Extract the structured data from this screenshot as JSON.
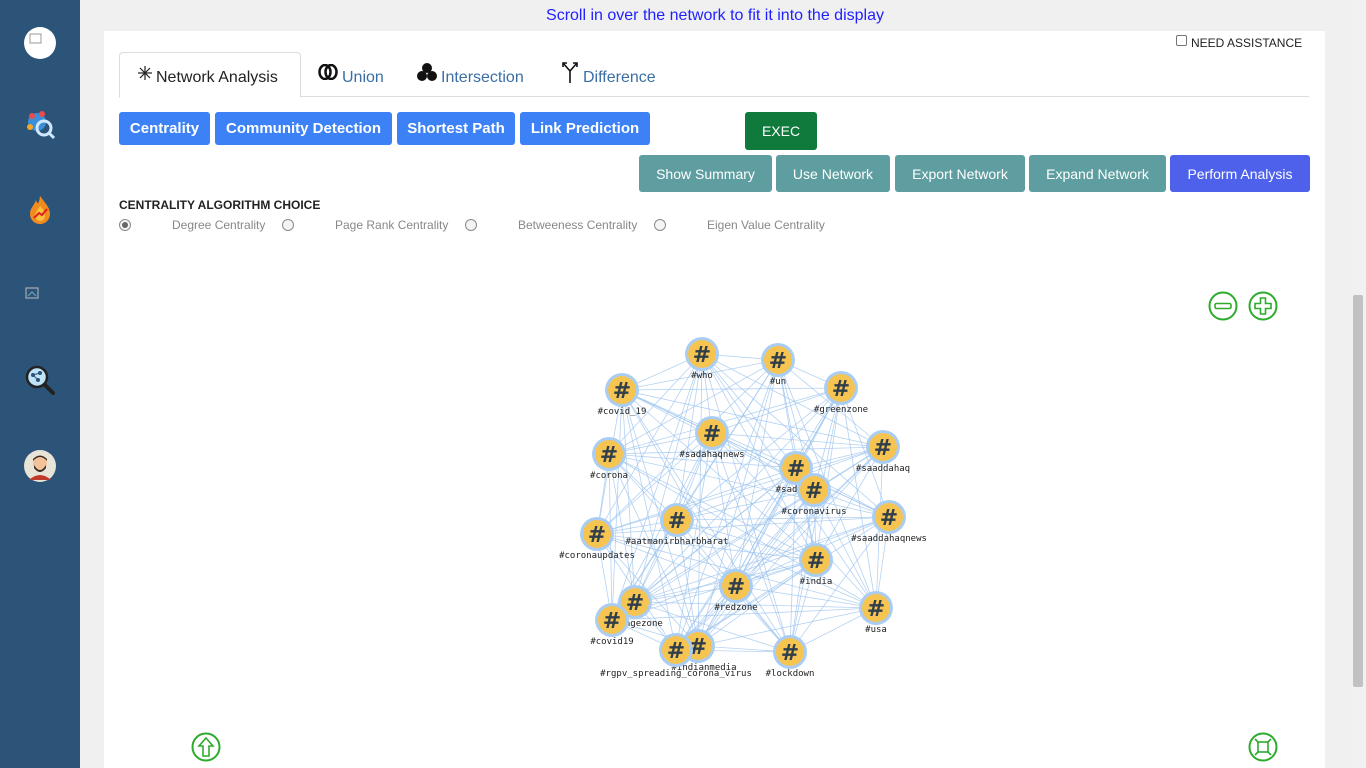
{
  "hint": "Scroll in over the network to fit it into the display",
  "assistance": {
    "label": "NEED ASSISTANCE",
    "checked": false
  },
  "tabs": [
    {
      "label": "Network Analysis",
      "icon": "asterisk-icon",
      "active": true
    },
    {
      "label": "Union",
      "icon": "union-rings-icon",
      "active": false
    },
    {
      "label": "Intersection",
      "icon": "intersection-circles-icon",
      "active": false
    },
    {
      "label": "Difference",
      "icon": "difference-fork-icon",
      "active": false
    }
  ],
  "analysis_buttons": [
    {
      "label": "Centrality"
    },
    {
      "label": "Community Detection"
    },
    {
      "label": "Shortest Path"
    },
    {
      "label": "Link Prediction"
    }
  ],
  "exec_label": "EXEC",
  "actions": [
    {
      "label": "Show Summary"
    },
    {
      "label": "Use Network"
    },
    {
      "label": "Export Network"
    },
    {
      "label": "Expand Network"
    },
    {
      "label": "Perform Analysis"
    }
  ],
  "algorithm": {
    "title": "CENTRALITY ALGORITHM CHOICE",
    "options": [
      {
        "label": "Degree Centrality",
        "selected": true
      },
      {
        "label": "Page Rank Centrality",
        "selected": false
      },
      {
        "label": "Betweeness Centrality",
        "selected": false
      },
      {
        "label": "Eigen Value Centrality",
        "selected": false
      }
    ]
  },
  "network": {
    "node_icon": "hashtag-icon",
    "nodes": [
      {
        "label": "#who"
      },
      {
        "label": "#un"
      },
      {
        "label": "#covid_19"
      },
      {
        "label": "#greenzone"
      },
      {
        "label": "#sadahaqnews"
      },
      {
        "label": "#corona"
      },
      {
        "label": "#saaddahaq"
      },
      {
        "label": "#sadah"
      },
      {
        "label": "#coronavirus"
      },
      {
        "label": "#saaddahaqnews"
      },
      {
        "label": "#aatmanirbharbharat"
      },
      {
        "label": "#coronaupdates"
      },
      {
        "label": "#india"
      },
      {
        "label": "#redzone"
      },
      {
        "label": "#orangezone"
      },
      {
        "label": "#usa"
      },
      {
        "label": "#covid19"
      },
      {
        "label": "#indianmedia"
      },
      {
        "label": "#rgpv_spreading_corona_virus"
      },
      {
        "label": "#lockdown"
      }
    ]
  },
  "controls": {
    "zoom_out": "minus-circle-icon",
    "zoom_in": "plus-circle-icon",
    "scroll_up": "arrow-up-circle-icon",
    "fit": "fit-screen-icon"
  },
  "colors": {
    "sidebar": "#2c5479",
    "primary_button": "#3c82f6",
    "exec_button": "#0f7a3c",
    "action_button": "#5f9ea0",
    "perform_button": "#4e61ea",
    "edge": "#9cc3ee",
    "node_fill": "#f5c451"
  }
}
